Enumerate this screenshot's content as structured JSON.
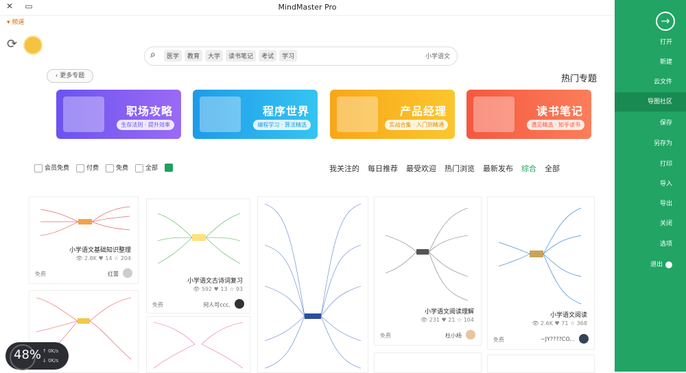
{
  "window": {
    "title": "MindMaster Pro",
    "close_glyph": "✕",
    "folder_glyph": "▭",
    "version_label": "▾ 频道"
  },
  "search": {
    "placeholder": "小学语文",
    "tags": [
      "学习",
      "考试",
      "读书笔记",
      "大学",
      "教育",
      "医学"
    ]
  },
  "more_topics": "更多专题",
  "section_title": "热门专题",
  "banners": [
    {
      "title": "读书笔记",
      "subtitle": "遇见精选 · 知乎读书"
    },
    {
      "title": "产品经理",
      "subtitle": "实战合集 · 入门到精通"
    },
    {
      "title": "程序世界",
      "subtitle": "编程学习 · 算法精选"
    },
    {
      "title": "职场攻略",
      "subtitle": "生存法则 · 提升效率"
    }
  ],
  "tabs": [
    "全部",
    "综合",
    "最新发布",
    "热门浏览",
    "最受欢迎",
    "每日推荐",
    "我关注的"
  ],
  "active_tab": "综合",
  "filters": {
    "all": "全部",
    "free": "免费",
    "paid": "付费",
    "member_free": "会员免费"
  },
  "cards": [
    {
      "title": "小学语文基础知识整理",
      "views": "2.8K",
      "likes": "14",
      "favs": "204",
      "author": "红蕾",
      "price": "免费"
    },
    {
      "title": "小学语文古诗词复习",
      "views": "592",
      "likes": "13",
      "favs": "93",
      "author": "何人可ccc.",
      "price": "免费"
    },
    {
      "title": "小学语文阅读理解",
      "views": "231",
      "likes": "21",
      "favs": "104",
      "author": "杜小杨",
      "price": "免费"
    },
    {
      "title": "小学语文阅读",
      "views": "2.6K",
      "likes": "71",
      "favs": "368",
      "author": "~JY????CO...",
      "price": "免费"
    }
  ],
  "sidebar": {
    "items": [
      "打开",
      "新建",
      "云文件",
      "导图社区",
      "保存",
      "另存为",
      "打印",
      "导入",
      "导出",
      "关闭",
      "选项",
      "退出"
    ],
    "active": "导图社区"
  },
  "widget": {
    "percent": "48%",
    "up": "0K/s",
    "down": "0K/s"
  },
  "colors": {
    "sidebar_green": "#21a464",
    "accent_green": "#1ba260"
  }
}
